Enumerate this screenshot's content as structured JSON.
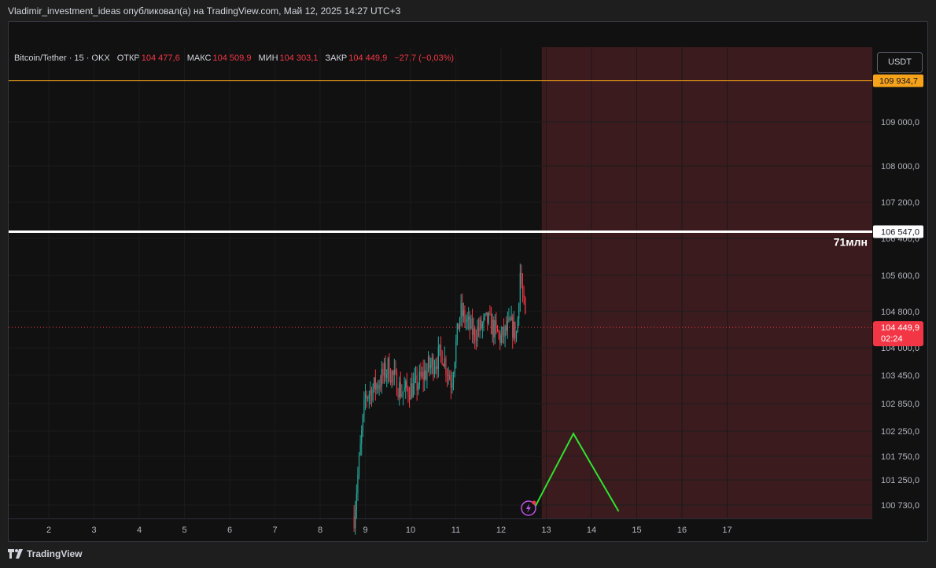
{
  "header": {
    "attribution": "Vladimir_investment_ideas опубликовал(а) на TradingView.com, Май 12, 2025 14:27 UTC+3"
  },
  "legend": {
    "symbol": "Bitcoin/Tether · 15 · OKX",
    "open_label": "ОТКР",
    "open_value": "104 477,6",
    "high_label": "МАКС",
    "high_value": "104 509,9",
    "low_label": "МИН",
    "low_value": "104 303,1",
    "close_label": "ЗАКР",
    "close_value": "104 449,9",
    "change": "−27,7 (−0,03%)"
  },
  "currency_button": "USDT",
  "footer": {
    "brand": "TradingView"
  },
  "colors": {
    "up": "#26a69a",
    "down": "#f23645",
    "orange_line": "#f7a21b",
    "forecast_zone": "#3b1b1e",
    "green_path": "#2fe22f",
    "white_line": "#ffffff"
  },
  "chart_data": {
    "type": "candlestick",
    "price_axis_ticks": [
      "109 000,0",
      "108 000,0",
      "107 200,0",
      "106 400,0",
      "105 600,0",
      "104 800,0",
      "104 000,0",
      "103 450,0",
      "102 850,0",
      "102 250,0",
      "101 750,0",
      "101 250,0",
      "100 730,0"
    ],
    "time_axis_ticks": [
      "2",
      "3",
      "4",
      "5",
      "6",
      "7",
      "8",
      "9",
      "10",
      "11",
      "12",
      "13",
      "14",
      "15",
      "16",
      "17"
    ],
    "horizontal_lines": [
      {
        "price": 109934.7,
        "label": "109 934,7",
        "color": "#f7a21b"
      },
      {
        "price": 106547.0,
        "label": "106 547,0",
        "color": "#ffffff",
        "annotation": "71млн"
      }
    ],
    "last_price": {
      "label": "104 449,9",
      "countdown": "02:24",
      "price": 104449.9
    },
    "forecast_zone_start_day": 12.9,
    "forecast_path": [
      {
        "day": 12.7,
        "price": 100600
      },
      {
        "day": 13.6,
        "price": 102200
      },
      {
        "day": 14.6,
        "price": 100600
      }
    ],
    "price_trend": [
      {
        "day": 8.75,
        "price": 100500
      },
      {
        "day": 8.85,
        "price": 101500
      },
      {
        "day": 9.0,
        "price": 103000
      },
      {
        "day": 9.3,
        "price": 103300
      },
      {
        "day": 9.5,
        "price": 103600
      },
      {
        "day": 9.8,
        "price": 103100
      },
      {
        "day": 10.1,
        "price": 103200
      },
      {
        "day": 10.4,
        "price": 103600
      },
      {
        "day": 10.7,
        "price": 103900
      },
      {
        "day": 10.9,
        "price": 103300
      },
      {
        "day": 11.1,
        "price": 104800
      },
      {
        "day": 11.4,
        "price": 104300
      },
      {
        "day": 11.7,
        "price": 104600
      },
      {
        "day": 12.0,
        "price": 104200
      },
      {
        "day": 12.2,
        "price": 104500
      },
      {
        "day": 12.35,
        "price": 104300
      },
      {
        "day": 12.42,
        "price": 105700
      },
      {
        "day": 12.55,
        "price": 104450
      }
    ]
  }
}
